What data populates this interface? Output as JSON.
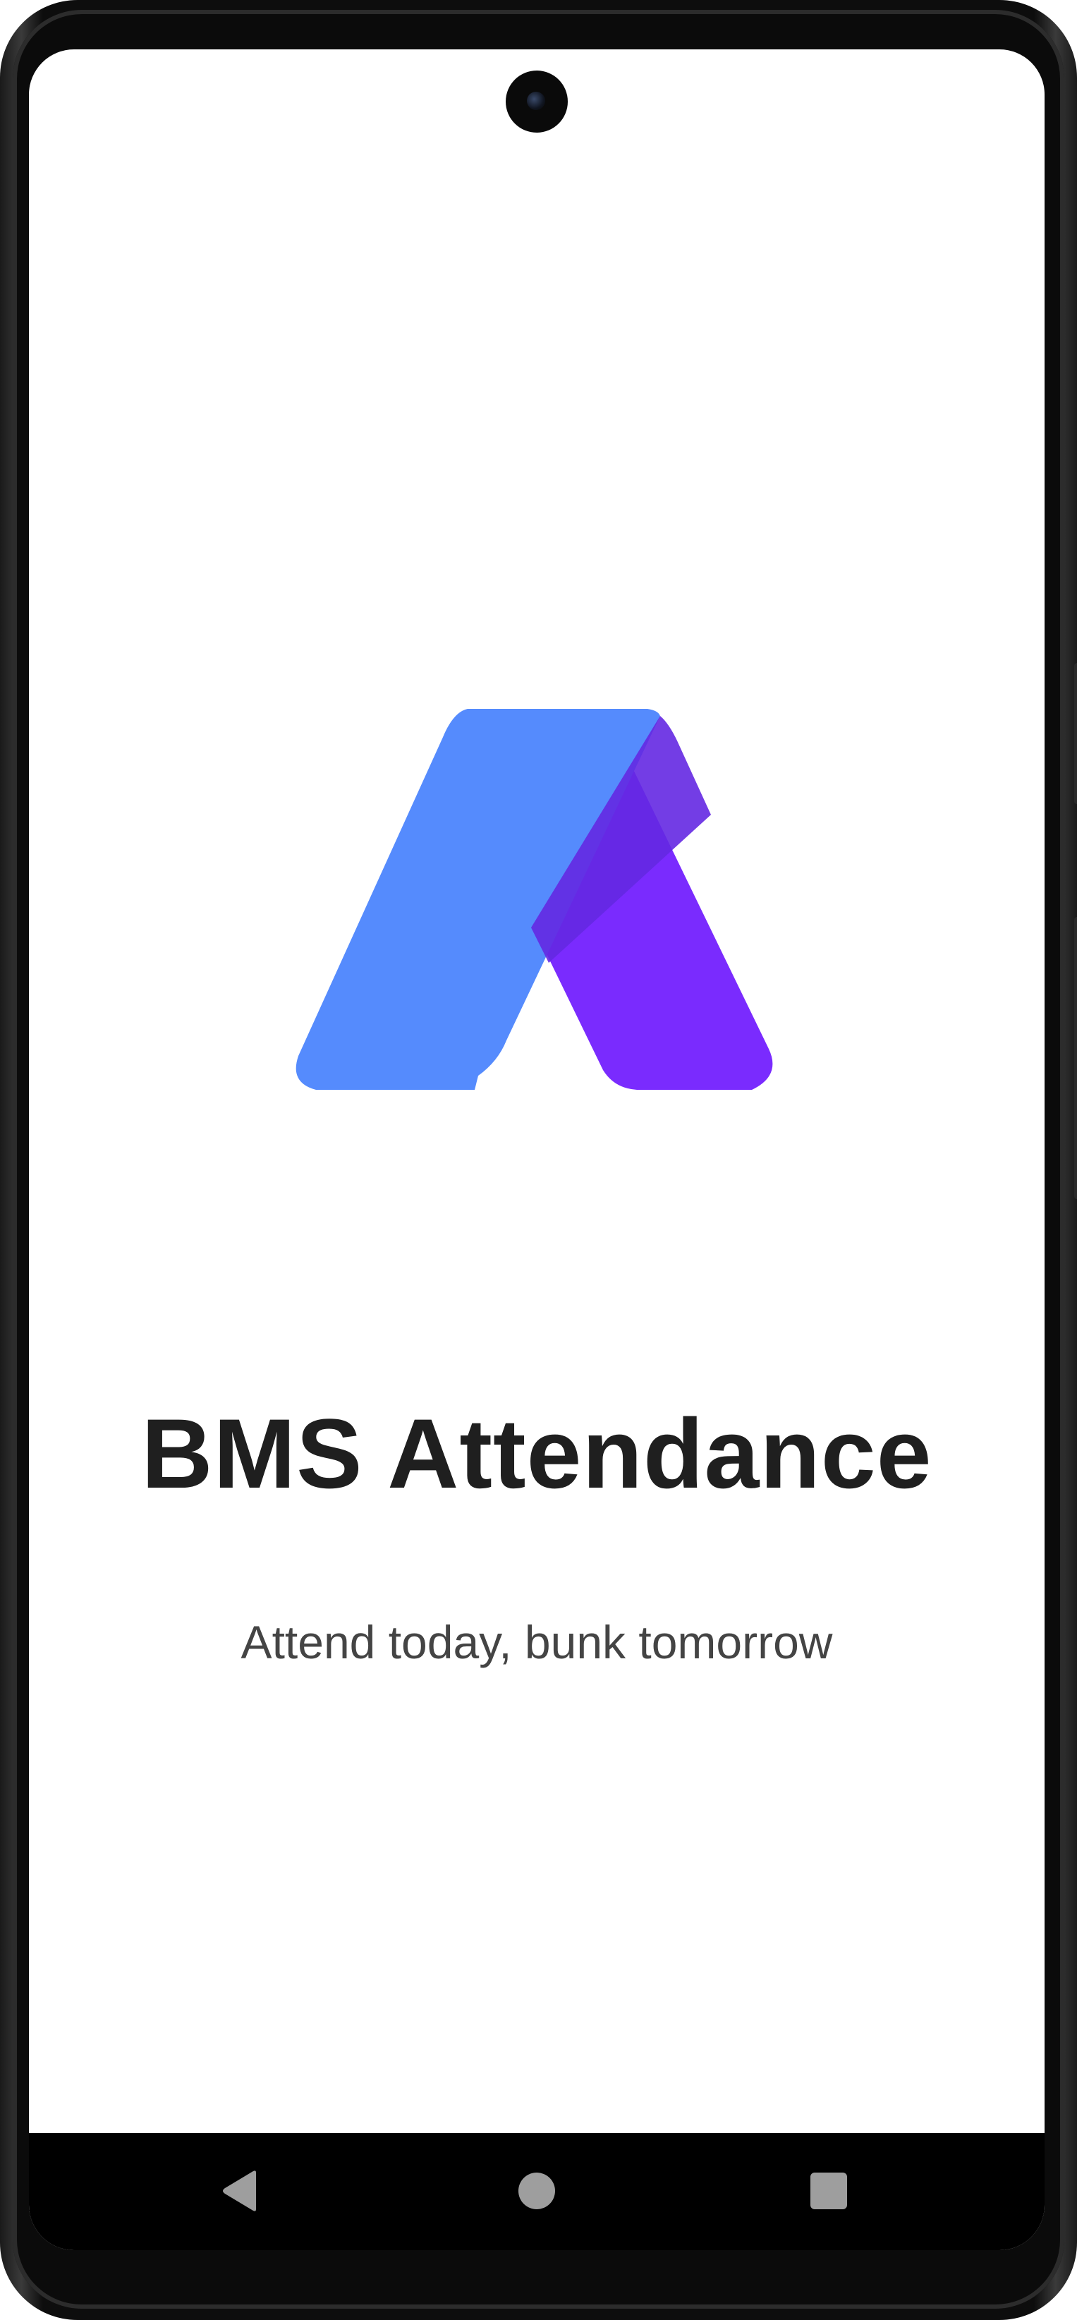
{
  "app": {
    "title": "BMS Attendance",
    "tagline": "Attend today, bunk tomorrow"
  },
  "logo": {
    "icon": "bms-a-logo-icon",
    "colors": {
      "left": "#558BFD",
      "right": "#7A2BFE",
      "overlap": "#6428E2"
    }
  },
  "system_nav": {
    "back_icon": "back-triangle-icon",
    "home_icon": "home-circle-icon",
    "recents_icon": "recents-square-icon"
  }
}
